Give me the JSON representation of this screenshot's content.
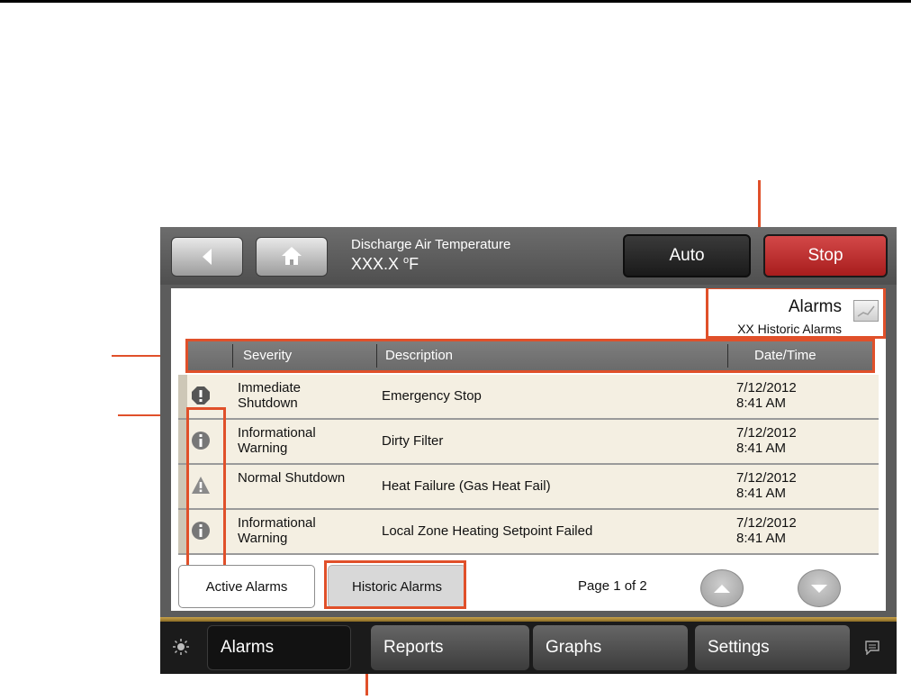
{
  "header": {
    "label": "Discharge Air Temperature",
    "value": "XXX.X",
    "unit_degree": "o",
    "unit_letter": "F",
    "auto_label": "Auto",
    "stop_label": "Stop"
  },
  "alarms_panel": {
    "title": "Alarms",
    "subtitle": "XX Historic Alarms"
  },
  "table": {
    "columns": [
      "Severity",
      "Description",
      "Date/Time"
    ],
    "rows": [
      {
        "severity": "Immediate Shutdown",
        "icon": "exclamation-octagon-icon",
        "description": "Emergency Stop",
        "date": "7/12/2012",
        "time": "8:41 AM"
      },
      {
        "severity": "Informational Warning",
        "icon": "info-circle-icon",
        "description": "Dirty Filter",
        "date": "7/12/2012",
        "time": "8:41 AM"
      },
      {
        "severity": "Normal Shutdown",
        "icon": "warning-triangle-icon",
        "description": "Heat Failure (Gas Heat Fail)",
        "date": "7/12/2012",
        "time": "8:41 AM"
      },
      {
        "severity": "Informational Warning",
        "icon": "info-circle-icon",
        "description": "Local Zone Heating Setpoint Failed",
        "date": "7/12/2012",
        "time": "8:41 AM"
      }
    ]
  },
  "footer": {
    "active_tab": "Active Alarms",
    "historic_tab": "Historic Alarms",
    "page_text": "Page 1 of 2"
  },
  "bottom_nav": {
    "items": [
      "Alarms",
      "Reports",
      "Graphs",
      "Settings"
    ],
    "selected": "Alarms"
  },
  "colors": {
    "callout": "#e0502a",
    "stop": "#c33030",
    "row_bg": "#f4efe2"
  }
}
